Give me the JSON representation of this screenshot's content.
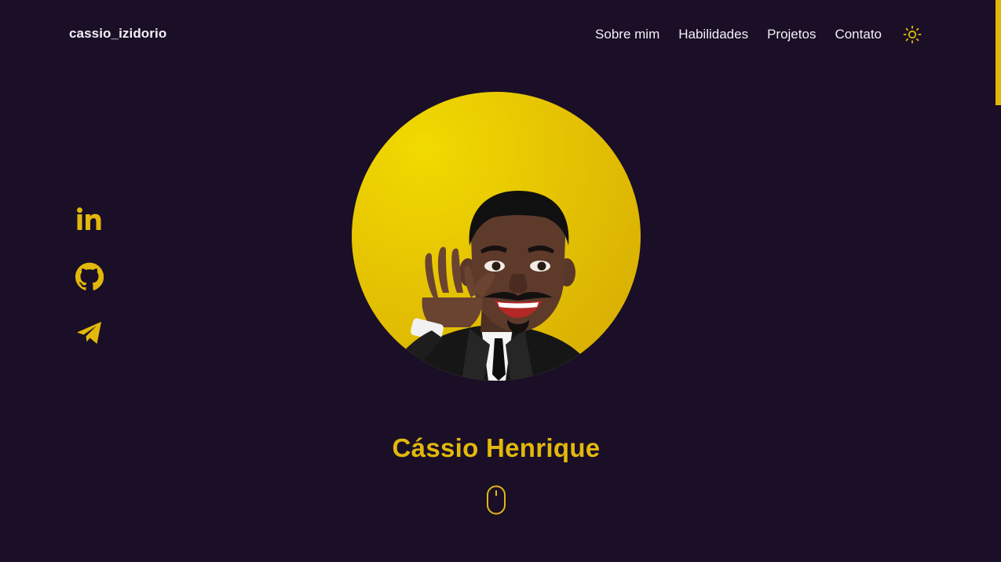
{
  "header": {
    "brand": "cassio_izidorio",
    "nav": {
      "about": "Sobre mim",
      "skills": "Habilidades",
      "projects": "Projetos",
      "contact": "Contato"
    },
    "theme_icon": "sun-icon"
  },
  "social": {
    "icons": [
      "linkedin-icon",
      "github-icon",
      "telegram-icon"
    ]
  },
  "hero": {
    "avatar_icon": "memoji-waving-avatar",
    "name": "Cássio Henrique",
    "scroll_icon": "mouse-scroll-icon"
  },
  "colors": {
    "background": "#1a0f26",
    "accent": "#e2b80c",
    "text": "#f4f0f8"
  }
}
